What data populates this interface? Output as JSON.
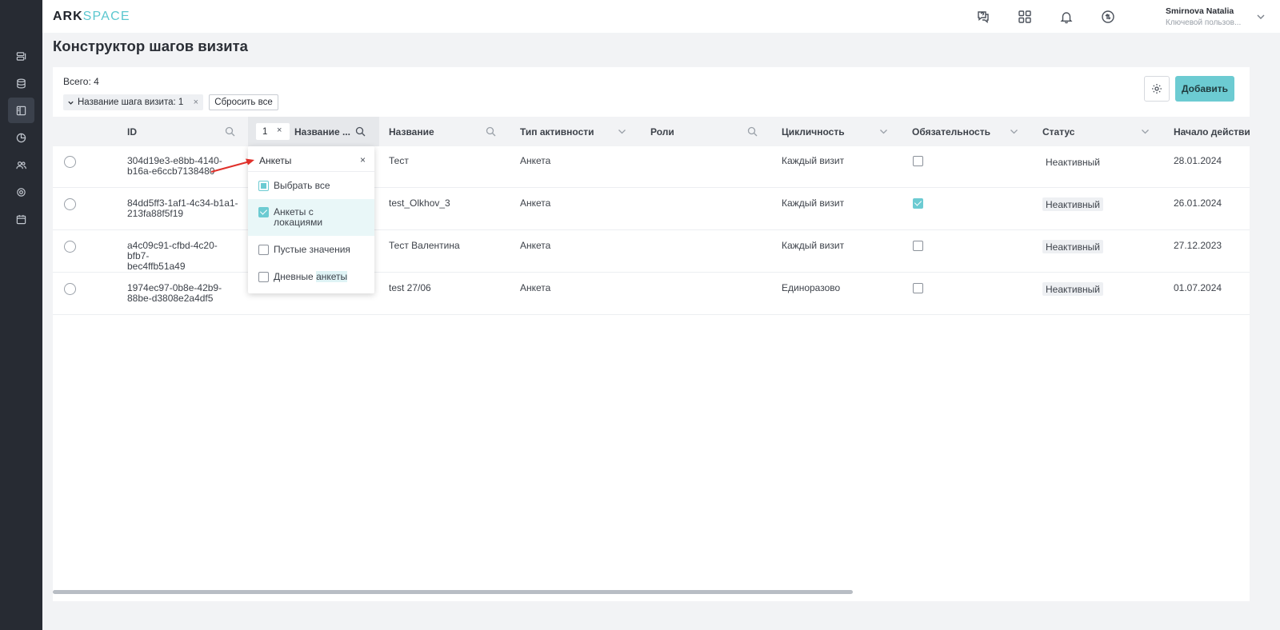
{
  "app": {
    "logo_part1": "ARK",
    "logo_part2": "SPACE",
    "accent_color": "#6ccbd2"
  },
  "sidebar": {
    "items": [
      {
        "icon": "list-icon",
        "active": false
      },
      {
        "icon": "database-icon",
        "active": false
      },
      {
        "icon": "layout-icon",
        "active": true
      },
      {
        "icon": "pie-chart-icon",
        "active": false
      },
      {
        "icon": "users-icon",
        "active": false
      },
      {
        "icon": "settings-icon",
        "active": false
      },
      {
        "icon": "calendar-icon",
        "active": false
      }
    ]
  },
  "header": {
    "icons": [
      "support-chat-icon",
      "apps-grid-icon",
      "bell-icon",
      "sync-icon"
    ],
    "user_name": "Smirnova Natalia",
    "user_role": "Ключевой пользов..."
  },
  "page": {
    "title": "Конструктор шагов визита",
    "total": "Всего: 4",
    "filter_chip": "Название шага визита: 1",
    "reset_label": "Сбросить все",
    "add_label": "Добавить"
  },
  "table": {
    "filter_count": "1",
    "columns": [
      {
        "label": "ID",
        "icon": "search-icon"
      },
      {
        "label": "Название ...",
        "icon": "search-icon"
      },
      {
        "label": "Название",
        "icon": "search-icon"
      },
      {
        "label": "Тип активности",
        "icon": "chevron-down-icon"
      },
      {
        "label": "Роли",
        "icon": "search-icon"
      },
      {
        "label": "Цикличность",
        "icon": "chevron-down-icon"
      },
      {
        "label": "Обязательность",
        "icon": "chevron-down-icon"
      },
      {
        "label": "Статус",
        "icon": "chevron-down-icon"
      },
      {
        "label": "Начало действи",
        "icon": ""
      }
    ],
    "rows": [
      {
        "id_line1": "304d19e3-e8bb-4140-",
        "id_line2": "b16a-e6ccb7138480",
        "name": "Тест",
        "activity": "Анкета",
        "roles": "",
        "cycle": "Каждый визит",
        "required": false,
        "status": "Неактивный",
        "start": "28.01.2024"
      },
      {
        "id_line1": "84dd5ff3-1af1-4c34-b1a1-",
        "id_line2": "213fa88f5f19",
        "name": "test_Olkhov_3",
        "activity": "Анкета",
        "roles": "",
        "cycle": "Каждый визит",
        "required": true,
        "status": "Неактивный",
        "start": "26.01.2024"
      },
      {
        "id_line1": "a4c09c91-cfbd-4c20-bfb7-",
        "id_line2": "bec4ffb51a49",
        "name": "Тест Валентина",
        "activity": "Анкета",
        "roles": "",
        "cycle": "Каждый визит",
        "required": false,
        "status": "Неактивный",
        "start": "27.12.2023"
      },
      {
        "id_line1": "1974ec97-0b8e-42b9-",
        "id_line2": "88be-d3808e2a4df5",
        "name": "test 27/06",
        "activity": "Анкета",
        "roles": "",
        "cycle": "Единоразово",
        "required": false,
        "status": "Неактивный",
        "start": "01.07.2024"
      }
    ]
  },
  "dropdown": {
    "search_value": "Анкеты",
    "clear": "×",
    "select_all": "Выбрать все",
    "option1_line1": "Анкеты с",
    "option1_line2": "локациями",
    "option2": "Пустые значения",
    "option3_part1": "Дневные ",
    "option3_part2": "анкеты"
  }
}
